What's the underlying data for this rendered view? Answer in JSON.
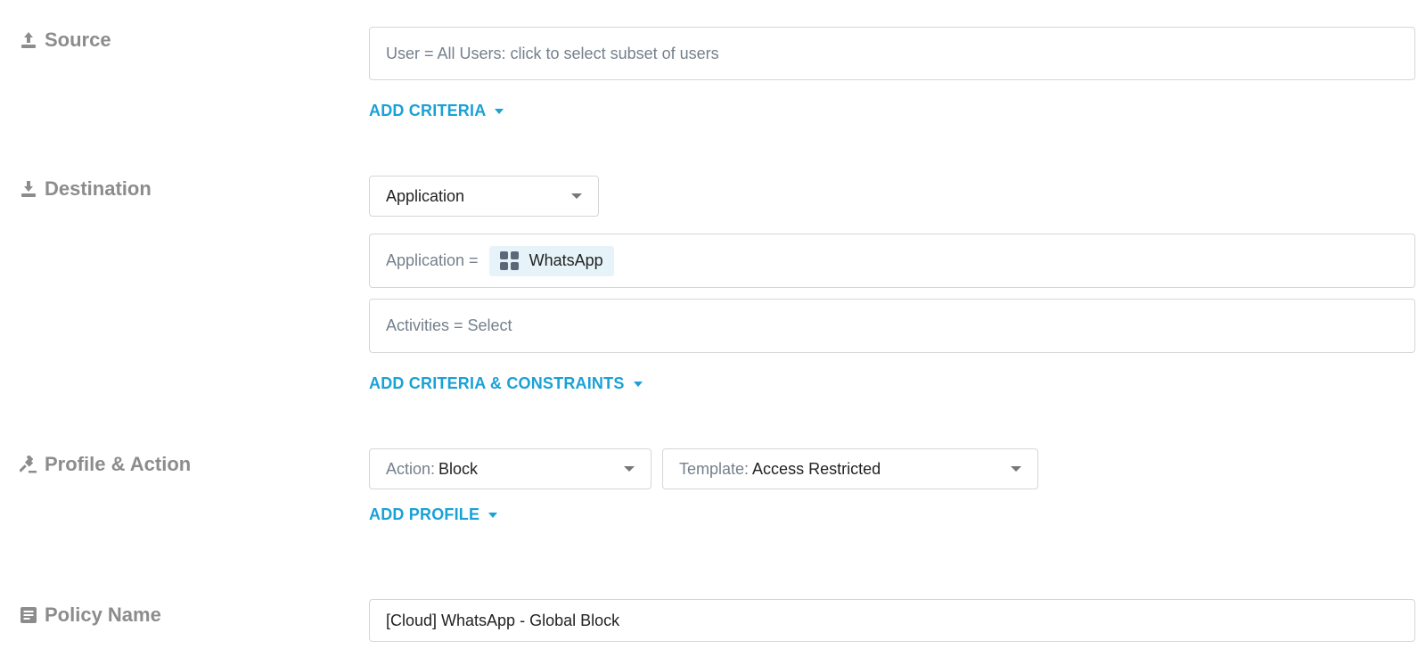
{
  "source": {
    "label": "Source",
    "icon": "upload-icon",
    "user_field": "User = All Users: click to select subset of users",
    "add_criteria": "ADD CRITERIA"
  },
  "destination": {
    "label": "Destination",
    "icon": "download-icon",
    "type_select": "Application",
    "application_prefix": "Application =",
    "application_chip": "WhatsApp",
    "activities_field": "Activities = Select",
    "add_criteria": "ADD CRITERIA & CONSTRAINTS"
  },
  "profile_action": {
    "label": "Profile & Action",
    "icon": "gavel-icon",
    "action_prefix": "Action:",
    "action_value": "Block",
    "template_prefix": "Template:",
    "template_value": "Access Restricted",
    "add_profile": "ADD PROFILE"
  },
  "policy_name": {
    "label": "Policy Name",
    "icon": "document-icon",
    "value": "[Cloud] WhatsApp - Global Block"
  },
  "colors": {
    "link": "#1aa1d6",
    "label_gray": "#8c8c8c",
    "border": "#d6d6d6",
    "chip_bg": "#e6f3f9"
  }
}
